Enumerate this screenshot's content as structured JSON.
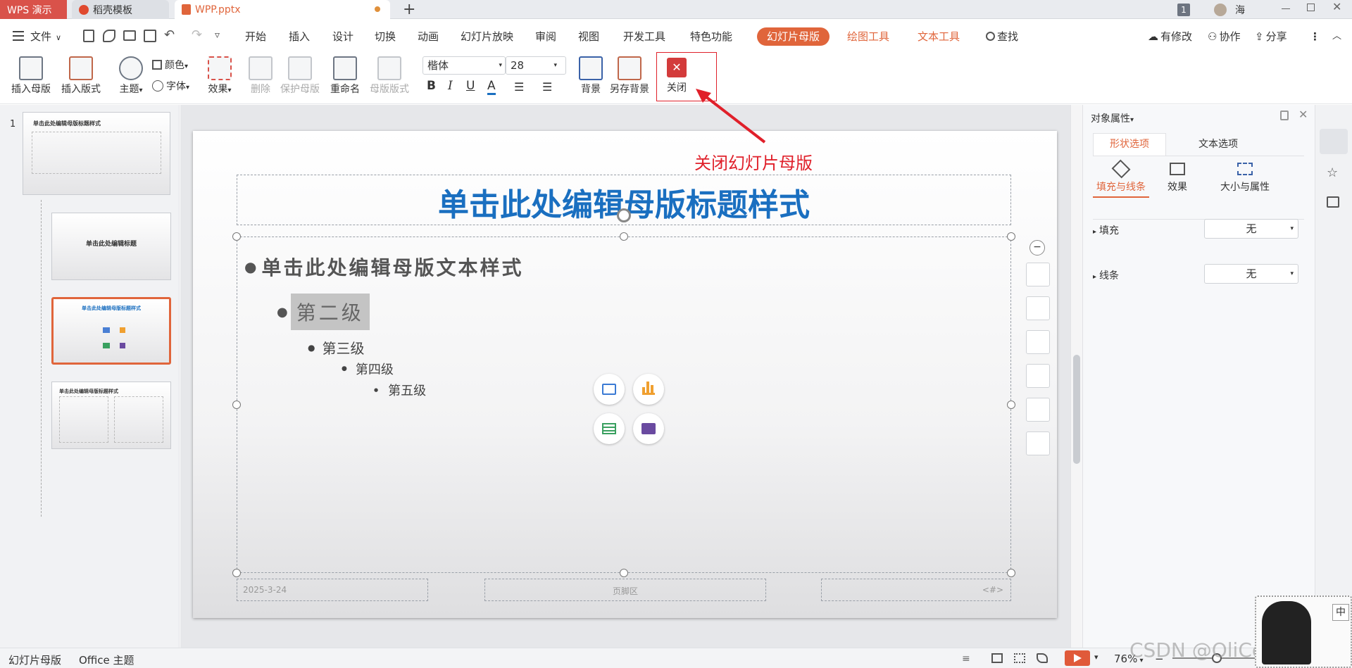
{
  "tabs": {
    "app": "WPS 演示",
    "template": "稻壳模板",
    "file": "WPP.pptx",
    "new_tab": "+",
    "badge": "1",
    "user": "海"
  },
  "menu": {
    "file": "文件",
    "items": [
      "开始",
      "插入",
      "设计",
      "切换",
      "动画",
      "幻灯片放映",
      "审阅",
      "视图",
      "开发工具",
      "特色功能"
    ],
    "context_active": "幻灯片母版",
    "context_tabs": [
      "绘图工具",
      "文本工具"
    ],
    "search": "查找",
    "right": [
      "有修改",
      "协作",
      "分享"
    ]
  },
  "ribbon": {
    "insert_master": "插入母版",
    "insert_layout": "插入版式",
    "theme": "主题",
    "color": "颜色",
    "font": "字体",
    "effect": "效果",
    "delete": "删除",
    "protect": "保护母版",
    "rename": "重命名",
    "master_layout": "母版版式",
    "font_name": "楷体",
    "font_size": "28",
    "background": "背景",
    "save_background": "另存背景",
    "close": "关闭"
  },
  "annotation": {
    "text": "关闭幻灯片母版",
    "color": "#e0202a"
  },
  "thumbnails": {
    "number": "1",
    "t1_title": "单击此处编辑母版标题样式",
    "t2_title": "单击此处编辑标题",
    "t3_title": "单击此处编辑母版标题样式",
    "t4_title": "单击此处编辑母版标题样式"
  },
  "slide": {
    "title": "单击此处编辑母版标题样式",
    "level1": "单击此处编辑母版文本样式",
    "level2": "第二级",
    "level3": "第三级",
    "level4": "第四级",
    "level5": "第五级",
    "date": "2025-3-24",
    "footer": "页脚区",
    "page_num": "<#>",
    "title_color": "#1a6fc0"
  },
  "properties": {
    "header": "对象属性",
    "tab_shape": "形状选项",
    "tab_text": "文本选项",
    "sub_fill_line": "填充与线条",
    "sub_effect": "效果",
    "sub_size": "大小与属性",
    "fill_label": "填充",
    "fill_value": "无",
    "line_label": "线条",
    "line_value": "无"
  },
  "status": {
    "left1": "幻灯片母版",
    "left2": "Office 主题",
    "zoom": "76%",
    "watermark": "CSDN @OliCorrect",
    "ime": "中"
  },
  "colors": {
    "accent": "#e0653b",
    "close_red": "#d33b3b"
  }
}
